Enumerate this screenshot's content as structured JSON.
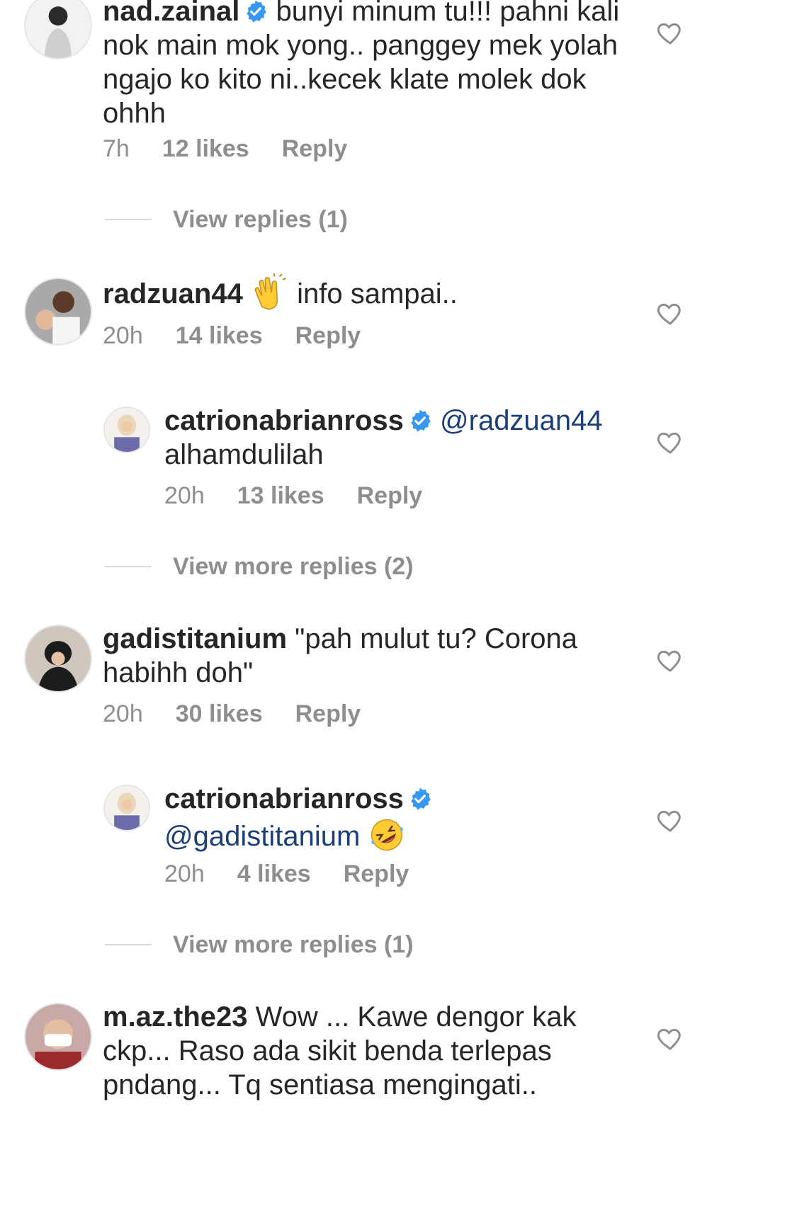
{
  "comments": [
    {
      "username": "nad.zainal",
      "verified": true,
      "text": "bunyi minum tu!!! pahni kali nok main mok yong.. panggey mek yolah ngajo ko kito ni..kecek klate molek dok ohhh",
      "time": "7h",
      "likes": "12 likes",
      "reply": "Reply",
      "view_replies": "View replies (1)"
    },
    {
      "username": "radzuan44",
      "verified": false,
      "emoji": "clapping-hands",
      "text": "info sampai..",
      "time": "20h",
      "likes": "14 likes",
      "reply": "Reply",
      "replies": [
        {
          "username": "catrionabrianross",
          "verified": true,
          "mention": "@radzuan44",
          "text": "alhamdulilah",
          "time": "20h",
          "likes": "13 likes",
          "reply": "Reply"
        }
      ],
      "view_replies": "View more replies (2)"
    },
    {
      "username": "gadistitanium",
      "verified": false,
      "text": "\"pah mulut tu? Corona habihh doh\"",
      "time": "20h",
      "likes": "30 likes",
      "reply": "Reply",
      "replies": [
        {
          "username": "catrionabrianross",
          "verified": true,
          "mention": "@gadistitanium",
          "emoji": "rolling-on-floor-laughing",
          "time": "20h",
          "likes": "4 likes",
          "reply": "Reply"
        }
      ],
      "view_replies": "View more replies (1)"
    },
    {
      "username": "m.az.the23",
      "verified": false,
      "text": "Wow ... Kawe dengor kak ckp... Raso ada sikit benda terlepas pndang... Tq sentiasa mengingati.."
    }
  ],
  "colors": {
    "text": "#262626",
    "meta": "#8e8e8e",
    "mention": "#1c3f7a",
    "verified": "#3897f0"
  }
}
